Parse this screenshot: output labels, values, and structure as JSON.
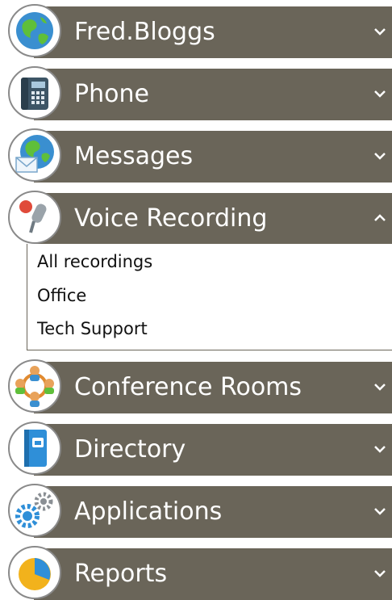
{
  "menu": {
    "sections": [
      {
        "label": "Fred.Bloggs",
        "icon": "globe-icon",
        "state": "collapsed"
      },
      {
        "label": "Phone",
        "icon": "desk-phone-icon",
        "state": "collapsed"
      },
      {
        "label": "Messages",
        "icon": "globe-envelope-icon",
        "state": "collapsed"
      },
      {
        "label": "Voice Recording",
        "icon": "microphone-icon",
        "state": "expanded",
        "items": [
          "All recordings",
          "Office",
          "Tech Support"
        ]
      },
      {
        "label": "Conference Rooms",
        "icon": "people-group-icon",
        "state": "collapsed"
      },
      {
        "label": "Directory",
        "icon": "phone-book-icon",
        "state": "collapsed"
      },
      {
        "label": "Applications",
        "icon": "gears-icon",
        "state": "collapsed"
      },
      {
        "label": "Reports",
        "icon": "pie-chart-icon",
        "state": "collapsed"
      }
    ]
  },
  "colors": {
    "header_bg": "#6a6559",
    "header_text": "#ffffff",
    "submenu_text": "#111111"
  }
}
